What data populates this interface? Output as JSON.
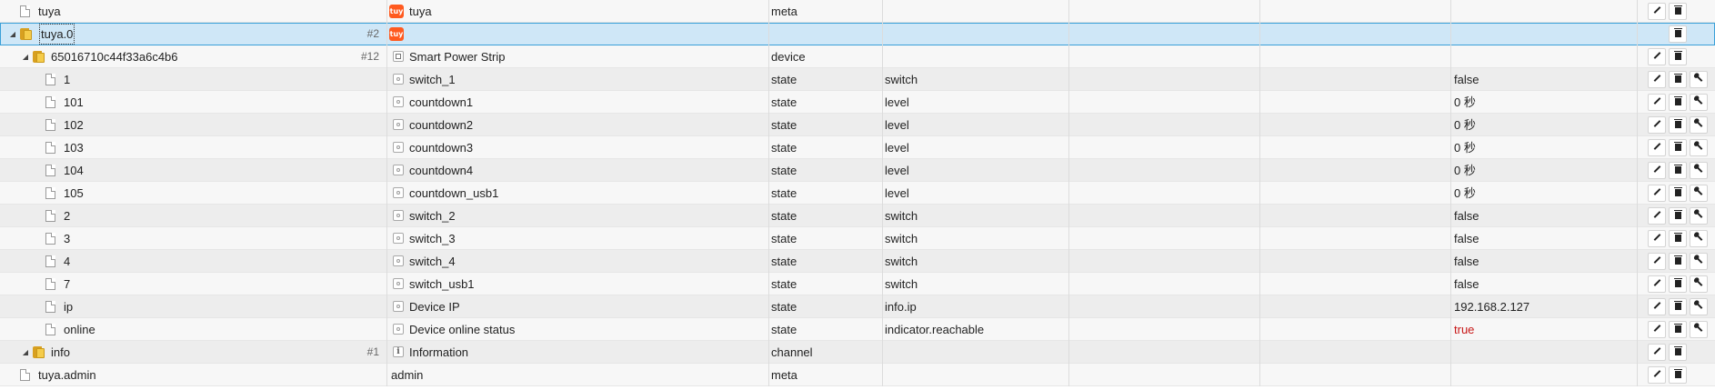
{
  "rows": [
    {
      "level": 0,
      "kind": "file",
      "expand": "",
      "id": "tuya",
      "count": "",
      "icon": "tuya",
      "name": "tuya",
      "type": "meta",
      "role": "",
      "value": "",
      "value_style": "",
      "actions": [
        "edit",
        "delete"
      ],
      "selected": false
    },
    {
      "level": 0,
      "kind": "folder",
      "expand": "open",
      "id": "tuya.0",
      "count": "#2",
      "icon": "tuya",
      "name": "",
      "type": "",
      "role": "",
      "value": "",
      "value_style": "",
      "actions": [
        "delete"
      ],
      "selected": true
    },
    {
      "level": 1,
      "kind": "folder",
      "expand": "open",
      "id": "65016710c44f33a6c4b6",
      "count": "#12",
      "icon": "device",
      "name": "Smart Power Strip",
      "type": "device",
      "role": "",
      "value": "",
      "value_style": "",
      "actions": [
        "edit",
        "delete"
      ],
      "selected": false
    },
    {
      "level": 2,
      "kind": "file",
      "expand": "",
      "id": "1",
      "count": "",
      "icon": "state",
      "name": "switch_1",
      "type": "state",
      "role": "switch",
      "value": "false",
      "value_style": "",
      "actions": [
        "edit",
        "delete",
        "config"
      ],
      "selected": false
    },
    {
      "level": 2,
      "kind": "file",
      "expand": "",
      "id": "101",
      "count": "",
      "icon": "state",
      "name": "countdown1",
      "type": "state",
      "role": "level",
      "value": "0 秒",
      "value_style": "",
      "actions": [
        "edit",
        "delete",
        "config"
      ],
      "selected": false
    },
    {
      "level": 2,
      "kind": "file",
      "expand": "",
      "id": "102",
      "count": "",
      "icon": "state",
      "name": "countdown2",
      "type": "state",
      "role": "level",
      "value": "0 秒",
      "value_style": "",
      "actions": [
        "edit",
        "delete",
        "config"
      ],
      "selected": false
    },
    {
      "level": 2,
      "kind": "file",
      "expand": "",
      "id": "103",
      "count": "",
      "icon": "state",
      "name": "countdown3",
      "type": "state",
      "role": "level",
      "value": "0 秒",
      "value_style": "",
      "actions": [
        "edit",
        "delete",
        "config"
      ],
      "selected": false
    },
    {
      "level": 2,
      "kind": "file",
      "expand": "",
      "id": "104",
      "count": "",
      "icon": "state",
      "name": "countdown4",
      "type": "state",
      "role": "level",
      "value": "0 秒",
      "value_style": "",
      "actions": [
        "edit",
        "delete",
        "config"
      ],
      "selected": false
    },
    {
      "level": 2,
      "kind": "file",
      "expand": "",
      "id": "105",
      "count": "",
      "icon": "state",
      "name": "countdown_usb1",
      "type": "state",
      "role": "level",
      "value": "0 秒",
      "value_style": "",
      "actions": [
        "edit",
        "delete",
        "config"
      ],
      "selected": false
    },
    {
      "level": 2,
      "kind": "file",
      "expand": "",
      "id": "2",
      "count": "",
      "icon": "state",
      "name": "switch_2",
      "type": "state",
      "role": "switch",
      "value": "false",
      "value_style": "",
      "actions": [
        "edit",
        "delete",
        "config"
      ],
      "selected": false
    },
    {
      "level": 2,
      "kind": "file",
      "expand": "",
      "id": "3",
      "count": "",
      "icon": "state",
      "name": "switch_3",
      "type": "state",
      "role": "switch",
      "value": "false",
      "value_style": "",
      "actions": [
        "edit",
        "delete",
        "config"
      ],
      "selected": false
    },
    {
      "level": 2,
      "kind": "file",
      "expand": "",
      "id": "4",
      "count": "",
      "icon": "state",
      "name": "switch_4",
      "type": "state",
      "role": "switch",
      "value": "false",
      "value_style": "",
      "actions": [
        "edit",
        "delete",
        "config"
      ],
      "selected": false
    },
    {
      "level": 2,
      "kind": "file",
      "expand": "",
      "id": "7",
      "count": "",
      "icon": "state",
      "name": "switch_usb1",
      "type": "state",
      "role": "switch",
      "value": "false",
      "value_style": "",
      "actions": [
        "edit",
        "delete",
        "config"
      ],
      "selected": false
    },
    {
      "level": 2,
      "kind": "file",
      "expand": "",
      "id": "ip",
      "count": "",
      "icon": "state",
      "name": "Device IP",
      "type": "state",
      "role": "info.ip",
      "value": "192.168.2.127",
      "value_style": "",
      "actions": [
        "edit",
        "delete",
        "config"
      ],
      "selected": false
    },
    {
      "level": 2,
      "kind": "file",
      "expand": "",
      "id": "online",
      "count": "",
      "icon": "state",
      "name": "Device online status",
      "type": "state",
      "role": "indicator.reachable",
      "value": "true",
      "value_style": "red",
      "actions": [
        "edit",
        "delete",
        "config"
      ],
      "selected": false
    },
    {
      "level": 1,
      "kind": "folder",
      "expand": "open",
      "id": "info",
      "count": "#1",
      "icon": "info",
      "name": "Information",
      "type": "channel",
      "role": "",
      "value": "",
      "value_style": "",
      "actions": [
        "edit",
        "delete"
      ],
      "selected": false
    },
    {
      "level": 0,
      "kind": "file",
      "expand": "",
      "id": "tuya.admin",
      "count": "",
      "icon": "",
      "name": "admin",
      "type": "meta",
      "role": "",
      "value": "",
      "value_style": "",
      "actions": [
        "edit",
        "delete"
      ],
      "selected": false
    }
  ],
  "icon_glyphs": {
    "tuya_logo_text": "tuy"
  },
  "colors": {
    "selected_bg": "#cfe7f7",
    "selected_border": "#3aa0d8",
    "tuya_brand": "#ff5a1f",
    "value_true": "#c81818"
  }
}
